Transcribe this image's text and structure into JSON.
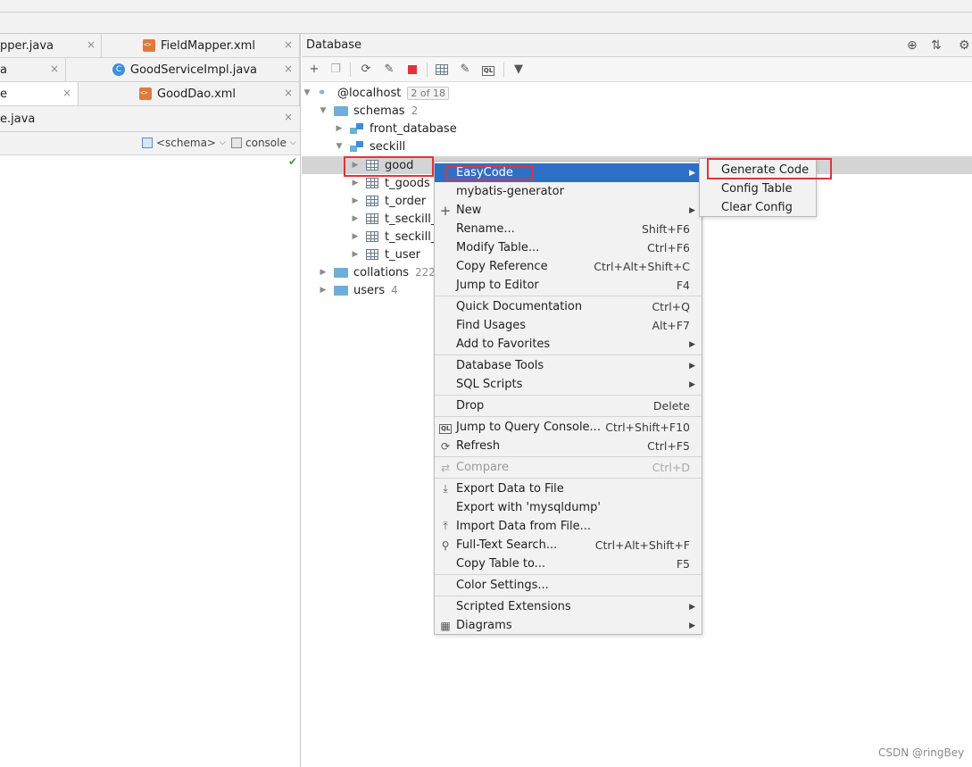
{
  "editor_tabs": {
    "row1": [
      {
        "label": "pper.java"
      },
      {
        "label": "FieldMapper.xml"
      }
    ],
    "row2": [
      {
        "label": "a"
      },
      {
        "label": "GoodServiceImpl.java"
      }
    ],
    "row3": [
      {
        "label": "e"
      },
      {
        "label": "GoodDao.xml"
      }
    ],
    "row4": [
      {
        "label": "e.java"
      }
    ],
    "close_glyph": "×"
  },
  "editor_toolbar": {
    "schema_label": "<schema>",
    "console_label": "console",
    "check_glyph": "✔"
  },
  "database_panel": {
    "title": "Database",
    "toolbar_icons": [
      "plus-icon",
      "copy-icon",
      "refresh-icon",
      "settings-icon",
      "stop-icon",
      "table-icon",
      "edit-icon",
      "sql-console-icon",
      "filter-icon"
    ],
    "tree": {
      "host": {
        "label": "@localhost",
        "badge": "2 of 18"
      },
      "schemas": {
        "label": "schemas",
        "count": "2"
      },
      "front_database": {
        "label": "front_database"
      },
      "seckill": {
        "label": "seckill"
      },
      "tables": [
        "good",
        "t_goods",
        "t_order",
        "t_seckill_g",
        "t_seckill_o",
        "t_user"
      ],
      "collations": {
        "label": "collations",
        "count": "222"
      },
      "users": {
        "label": "users",
        "count": "4"
      }
    }
  },
  "context_menu": {
    "items": [
      {
        "label": "EasyCode",
        "submenu": true
      },
      {
        "label": "mybatis-generator"
      },
      {
        "label": "New",
        "icon": "plus-icon",
        "submenu": true
      },
      {
        "label": "Rename...",
        "shortcut": "Shift+F6"
      },
      {
        "label": "Modify Table...",
        "shortcut": "Ctrl+F6"
      },
      {
        "label": "Copy Reference",
        "shortcut": "Ctrl+Alt+Shift+C"
      },
      {
        "label": "Jump to Editor",
        "shortcut": "F4"
      },
      {
        "label": "Quick Documentation",
        "shortcut": "Ctrl+Q"
      },
      {
        "label": "Find Usages",
        "shortcut": "Alt+F7"
      },
      {
        "label": "Add to Favorites",
        "submenu": true
      },
      {
        "label": "Database Tools",
        "submenu": true
      },
      {
        "label": "SQL Scripts",
        "submenu": true
      },
      {
        "label": "Drop",
        "shortcut": "Delete"
      },
      {
        "label": "Jump to Query Console...",
        "shortcut": "Ctrl+Shift+F10"
      },
      {
        "label": "Refresh",
        "shortcut": "Ctrl+F5"
      },
      {
        "label": "Compare",
        "shortcut": "Ctrl+D",
        "disabled": true
      },
      {
        "label": "Export Data to File"
      },
      {
        "label": "Export with 'mysqldump'"
      },
      {
        "label": "Import Data from File..."
      },
      {
        "label": "Full-Text Search...",
        "shortcut": "Ctrl+Alt+Shift+F"
      },
      {
        "label": "Copy Table to...",
        "shortcut": "F5"
      },
      {
        "label": "Color Settings..."
      },
      {
        "label": "Scripted Extensions",
        "submenu": true
      },
      {
        "label": "Diagrams",
        "submenu": true
      }
    ]
  },
  "easycode_submenu": {
    "items": [
      "Generate Code",
      "Config Table",
      "Clear Config"
    ]
  },
  "watermark": "CSDN @ringBey",
  "colors": {
    "highlight": "#2f6fc6",
    "annotation_red": "#e0343b",
    "selection_gray": "#d4d4d4"
  }
}
